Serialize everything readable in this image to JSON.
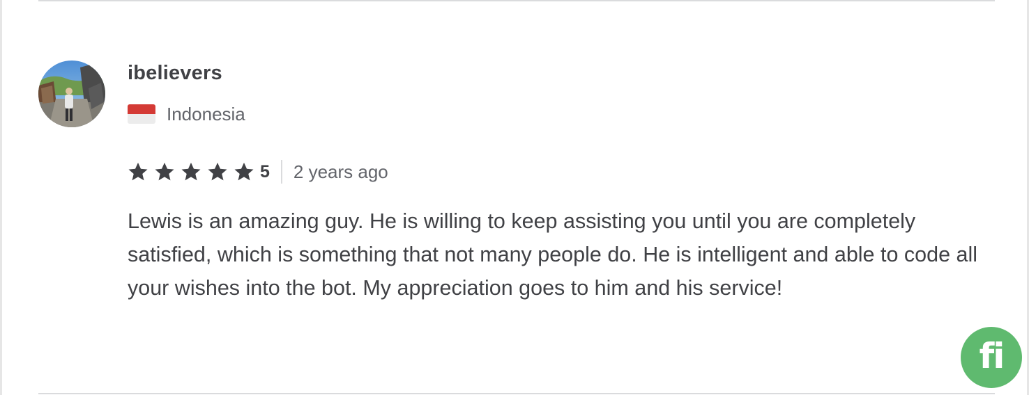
{
  "review": {
    "username": "ibelievers",
    "country": "Indonesia",
    "rating": "5",
    "stars_filled": 5,
    "stars_total": 5,
    "time_ago": "2 years ago",
    "text": "Lewis is an amazing guy. He is willing to keep assisting you until you are completely satisfied, which is something that not many people do. He is intelligent and able to code all your wishes into the bot. My appreciation goes to him and his service!",
    "flag_icon": "indonesia-flag-icon",
    "star_icon": "star-icon"
  },
  "widget": {
    "logo_text": "fi",
    "icon": "fiverr-logo-icon",
    "color": "#5fba6f"
  },
  "colors": {
    "text_primary": "#404145",
    "text_secondary": "#62646a",
    "divider": "#dadbdd",
    "flag_red": "#d43a35"
  }
}
